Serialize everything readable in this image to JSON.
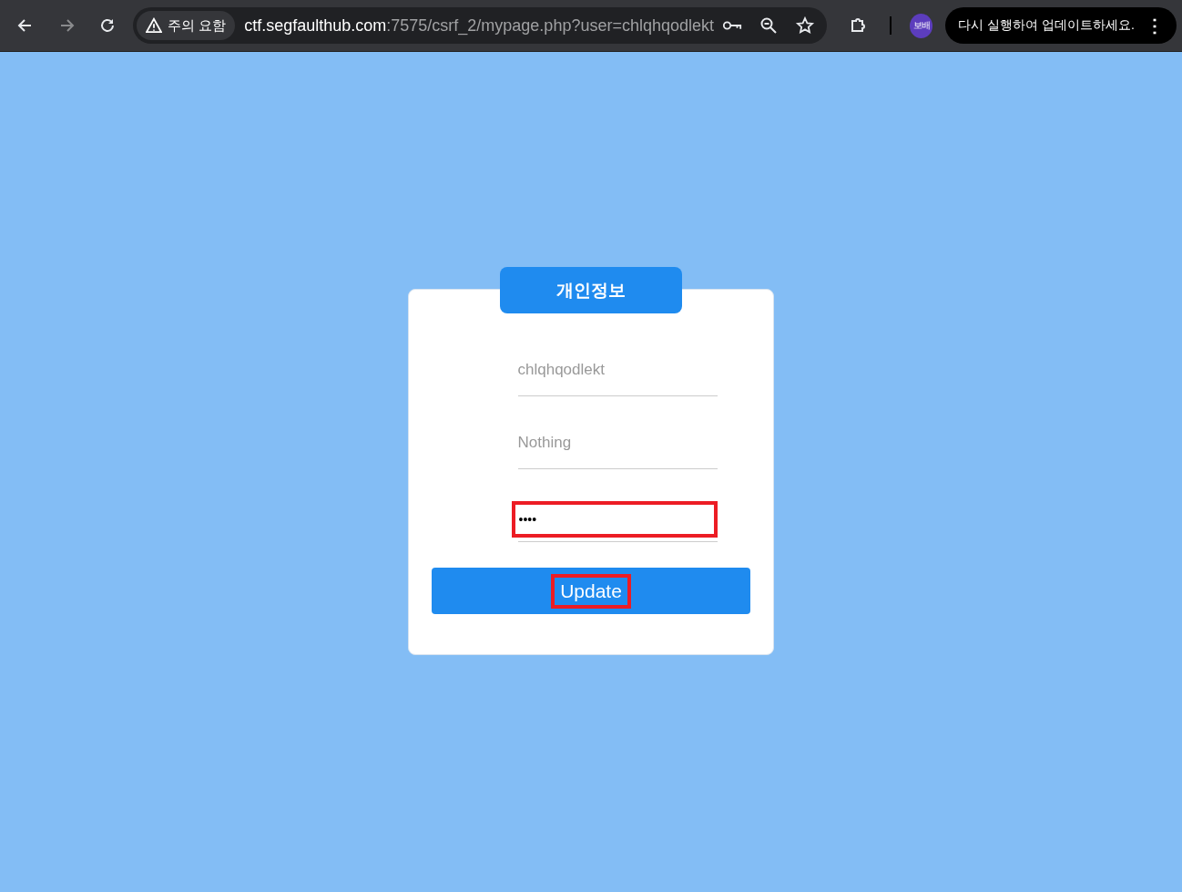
{
  "browser": {
    "security_chip": "주의 요함",
    "url_host": "ctf.segfaulthub.com",
    "url_rest": ":7575/csrf_2/mypage.php?user=chlqhqodlekt",
    "profile": "보배",
    "update_prompt": "다시 실행하여 업데이트하세요.",
    "menu_glyph": "⋮"
  },
  "card": {
    "title": "개인정보",
    "fields": [
      {
        "kind": "text",
        "placeholder": "chlqhqodlekt",
        "highlighted": false
      },
      {
        "kind": "text",
        "placeholder": "Nothing",
        "highlighted": false
      },
      {
        "kind": "password",
        "value": "••••",
        "highlighted": true
      }
    ],
    "button": {
      "label": "Update",
      "highlighted": true
    }
  }
}
